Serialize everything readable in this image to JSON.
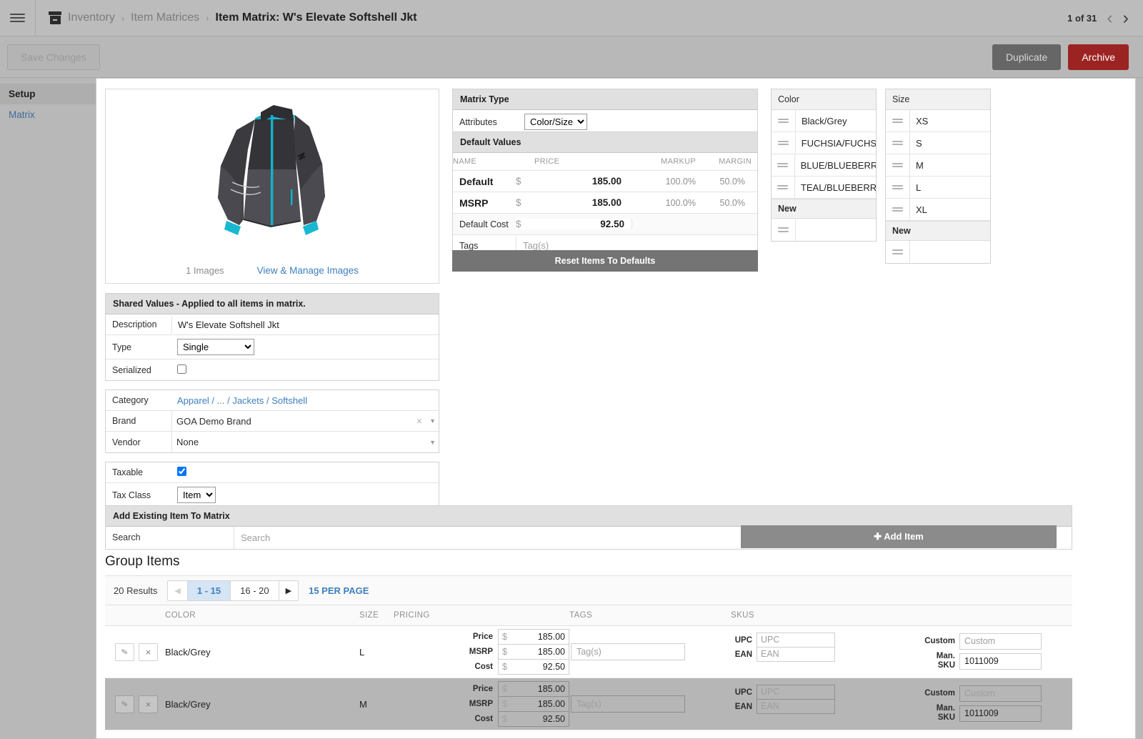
{
  "header": {
    "menu_icon": "hamburger-icon",
    "module_icon": "inventory-box-icon",
    "breadcrumbs": [
      "Inventory",
      "Item Matrices",
      "Item Matrix: W's Elevate Softshell Jkt"
    ],
    "separator": "›",
    "record_position": "1 of 31",
    "prev_icon": "‹",
    "next_icon": "›"
  },
  "actionbar": {
    "save_label": "Save Changes",
    "duplicate_label": "Duplicate",
    "archive_label": "Archive",
    "archive_color": "#9b2423"
  },
  "sidebar": {
    "section": "Setup",
    "items": [
      {
        "label": "Matrix",
        "active": true
      }
    ]
  },
  "image_card": {
    "count_label": "1 Images",
    "manage_link": "View & Manage Images",
    "link_color": "#3f7fbf"
  },
  "matrix_type": {
    "title": "Matrix Type",
    "attributes_label": "Attributes",
    "attributes_value": "Color/Size",
    "attributes_options": [
      "Color/Size"
    ]
  },
  "default_values": {
    "title": "Default Values",
    "columns": [
      "NAME",
      "PRICE",
      "MARKUP",
      "MARGIN"
    ],
    "rows": [
      {
        "name": "Default",
        "currency": "$",
        "price": "185.00",
        "markup": "100.0%",
        "margin": "50.0%"
      },
      {
        "name": "MSRP",
        "currency": "$",
        "price": "185.00",
        "markup": "100.0%",
        "margin": "50.0%"
      }
    ],
    "default_cost_label": "Default Cost",
    "default_cost_currency": "$",
    "default_cost_value": "92.50",
    "tags_label": "Tags",
    "tags_placeholder": "Tag(s)",
    "reset_label": "Reset Items To Defaults"
  },
  "attributes": {
    "color": {
      "title": "Color",
      "values": [
        "Black/Grey",
        "FUCHSIA/FUCHS",
        "BLUE/BLUEBERR'",
        "TEAL/BLUEBERR'"
      ],
      "new_label": "New",
      "new_value": ""
    },
    "size": {
      "title": "Size",
      "values": [
        "XS",
        "S",
        "M",
        "L",
        "XL"
      ],
      "new_label": "New",
      "new_value": ""
    }
  },
  "shared_values": {
    "title": "Shared Values - Applied to all items in matrix.",
    "description_label": "Description",
    "description_value": "W's Elevate Softshell Jkt",
    "type_label": "Type",
    "type_value": "Single",
    "type_options": [
      "Single"
    ],
    "serialized_label": "Serialized",
    "serialized_checked": false,
    "category_label": "Category",
    "category_value": "Apparel / ... / Jackets / Softshell",
    "brand_label": "Brand",
    "brand_value": "GOA Demo Brand",
    "vendor_label": "Vendor",
    "vendor_value": "None",
    "taxable_label": "Taxable",
    "taxable_checked": true,
    "tax_class_label": "Tax Class",
    "tax_class_value": "Item",
    "tax_class_options": [
      "Item"
    ]
  },
  "add_existing": {
    "title": "Add Existing Item To Matrix",
    "search_label": "Search",
    "search_placeholder": "Search",
    "search_value": "",
    "add_item_label": "Add Item",
    "add_item_icon": "plus-icon"
  },
  "group_items": {
    "title": "Group Items",
    "results_label": "20 Results",
    "pages": [
      {
        "label": "1 - 15",
        "selected": true
      },
      {
        "label": "16 - 20",
        "selected": false
      }
    ],
    "prev_icon": "◀",
    "next_icon": "▶",
    "per_page_label": "15 PER PAGE",
    "columns": [
      "COLOR",
      "SIZE",
      "PRICING",
      "TAGS",
      "SKUS"
    ],
    "rows": [
      {
        "edit_icon": "pencil-icon",
        "delete_icon": "x-icon",
        "color": "Black/Grey",
        "size": "L",
        "pricing": [
          {
            "label": "Price",
            "currency": "$",
            "value": "185.00"
          },
          {
            "label": "MSRP",
            "currency": "$",
            "value": "185.00"
          },
          {
            "label": "Cost",
            "currency": "$",
            "value": "92.50"
          }
        ],
        "tags_placeholder": "Tag(s)",
        "tags_value": "",
        "upc_label": "UPC",
        "upc_placeholder": "UPC",
        "upc_value": "",
        "ean_label": "EAN",
        "ean_placeholder": "EAN",
        "ean_value": "",
        "custom_label": "Custom",
        "custom_placeholder": "Custom",
        "custom_value": "",
        "mansku_label": "Man. SKU",
        "mansku_value": "1011009",
        "highlighted": false
      },
      {
        "edit_icon": "pencil-icon",
        "delete_icon": "x-icon",
        "color": "Black/Grey",
        "size": "M",
        "pricing": [
          {
            "label": "Price",
            "currency": "$",
            "value": "185.00"
          },
          {
            "label": "MSRP",
            "currency": "$",
            "value": "185.00"
          },
          {
            "label": "Cost",
            "currency": "$",
            "value": "92.50"
          }
        ],
        "tags_placeholder": "Tag(s)",
        "tags_value": "",
        "upc_label": "UPC",
        "upc_placeholder": "UPC",
        "upc_value": "",
        "ean_label": "EAN",
        "ean_placeholder": "EAN",
        "ean_value": "",
        "custom_label": "Custom",
        "custom_placeholder": "Custom",
        "custom_value": "",
        "mansku_label": "Man. SKU",
        "mansku_value": "1011009",
        "highlighted": true
      }
    ]
  }
}
